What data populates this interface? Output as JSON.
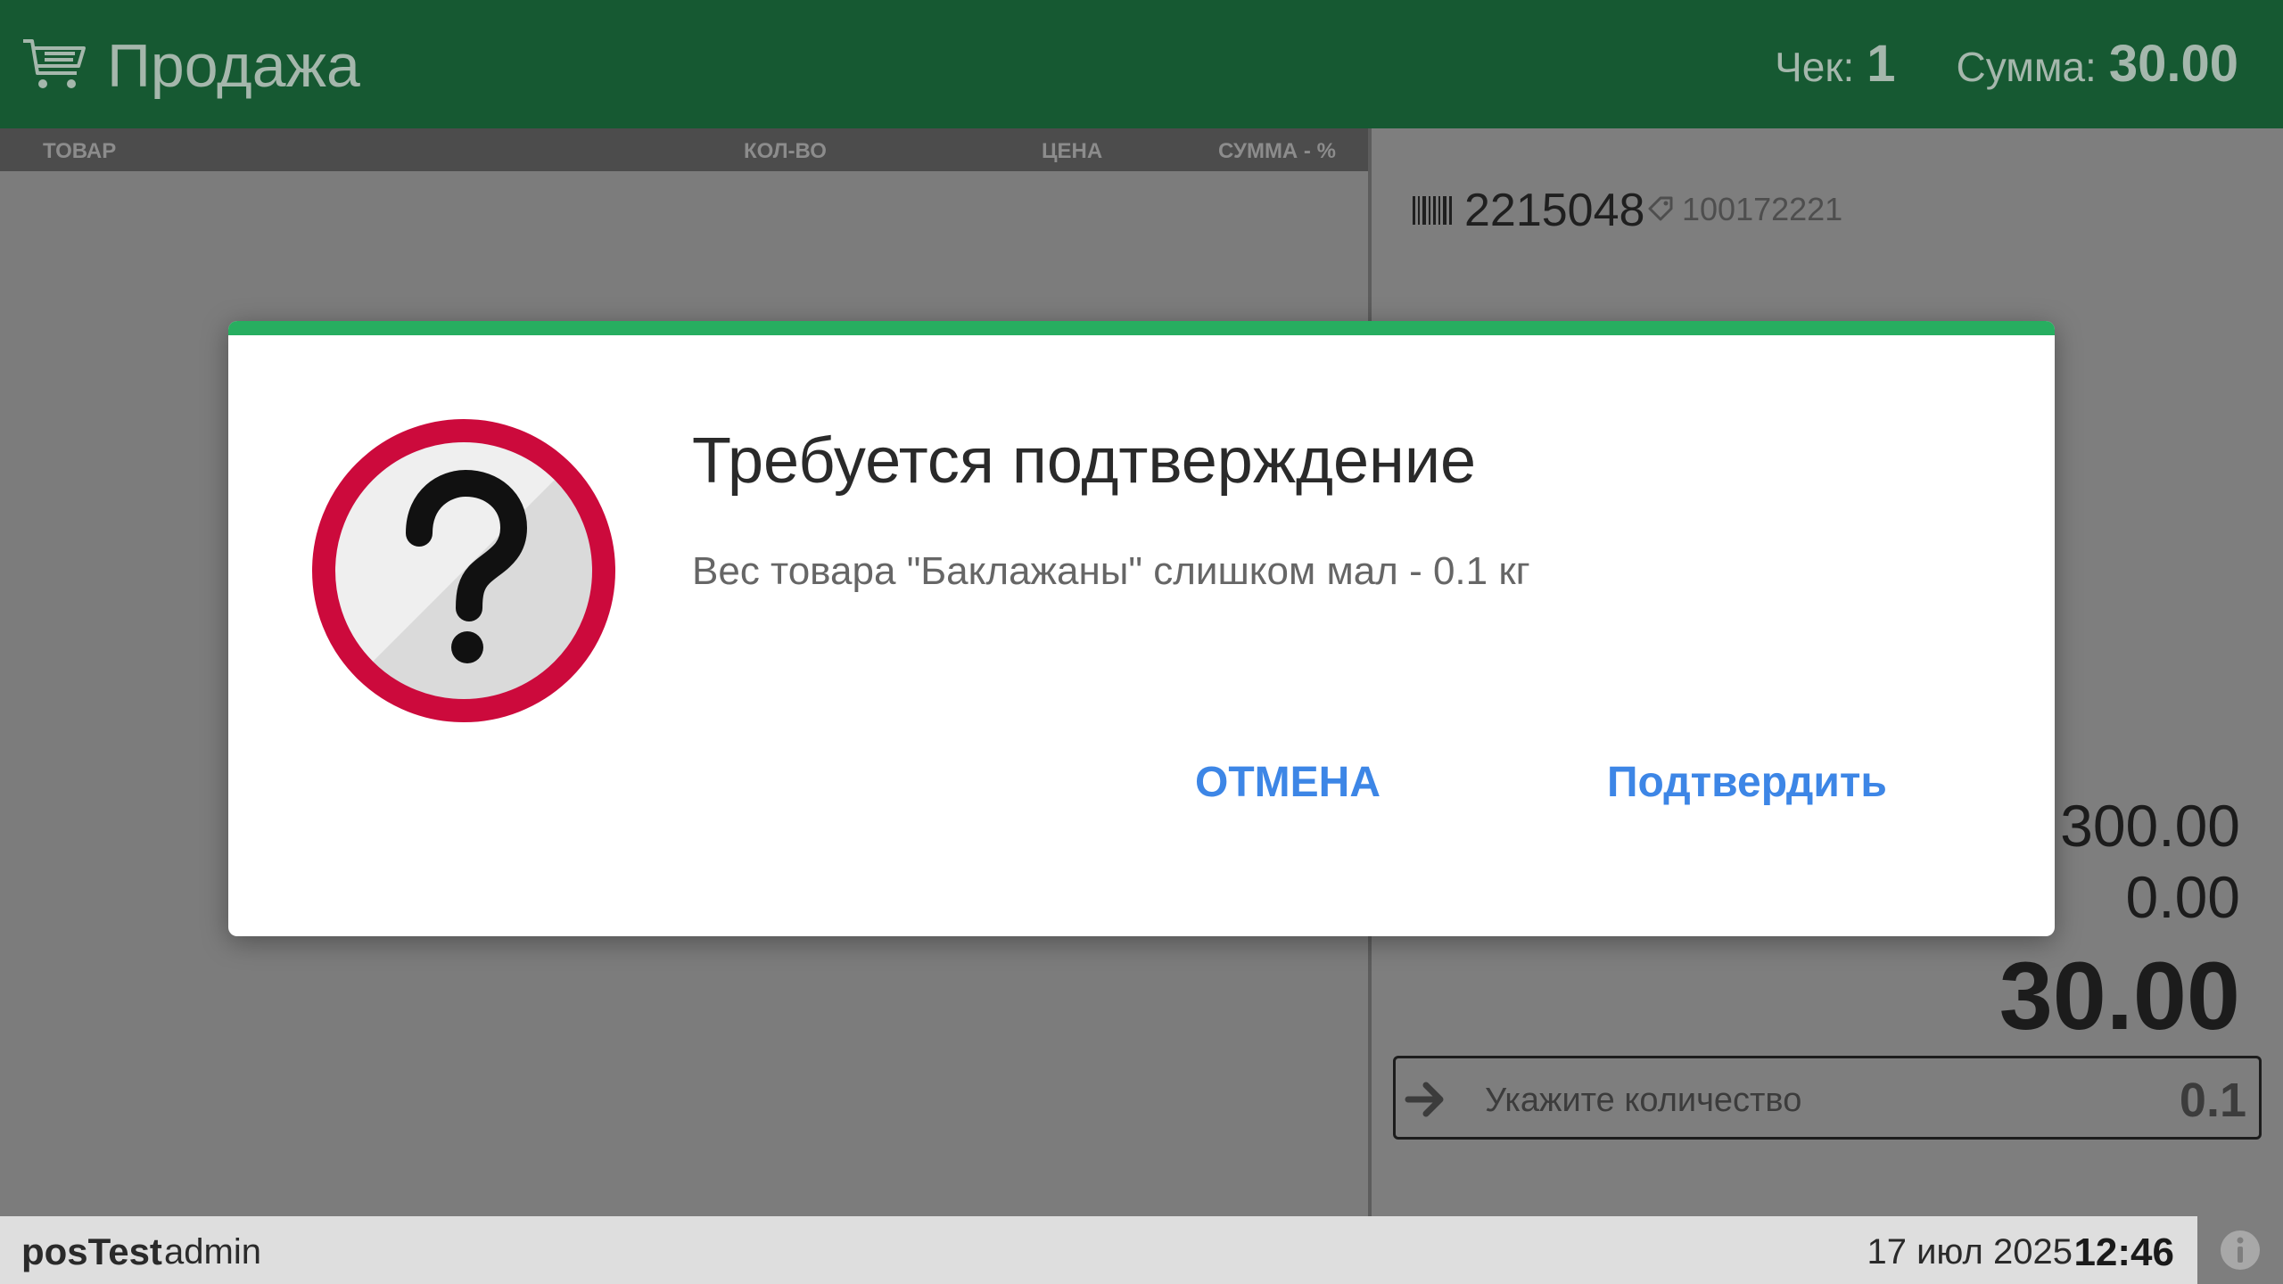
{
  "header": {
    "title": "Продажа",
    "check_label": "Чек:",
    "check_value": "1",
    "sum_label": "Сумма:",
    "sum_value": "30.00"
  },
  "table": {
    "columns": [
      "ТОВАР",
      "КОЛ-ВО",
      "ЦЕНА",
      "СУММА - %"
    ]
  },
  "product": {
    "barcode": "2215048",
    "article": "100172221"
  },
  "totals": {
    "line1": "300.00",
    "line2": "0.00",
    "total": "30.00"
  },
  "quantity_input": {
    "placeholder": "Укажите количество",
    "value": "0.1"
  },
  "footer": {
    "pos_name": "posTest",
    "user": "admin",
    "date": "17 июл 2025",
    "time": "12:46"
  },
  "dialog": {
    "title": "Требуется подтверждение",
    "message": "Вес товара \"Баклажаны\" слишком мал - 0.1 кг",
    "cancel_label": "ОТМЕНА",
    "confirm_label": "Подтвердить"
  },
  "colors": {
    "header_bg": "#165932",
    "dialog_accent": "#27ae60",
    "button_text": "#3d86e6",
    "question_ring": "#cc0a3c"
  },
  "icons": [
    "cart-icon",
    "barcode-icon",
    "tag-icon",
    "arrow-right-icon",
    "question-icon",
    "info-icon"
  ]
}
